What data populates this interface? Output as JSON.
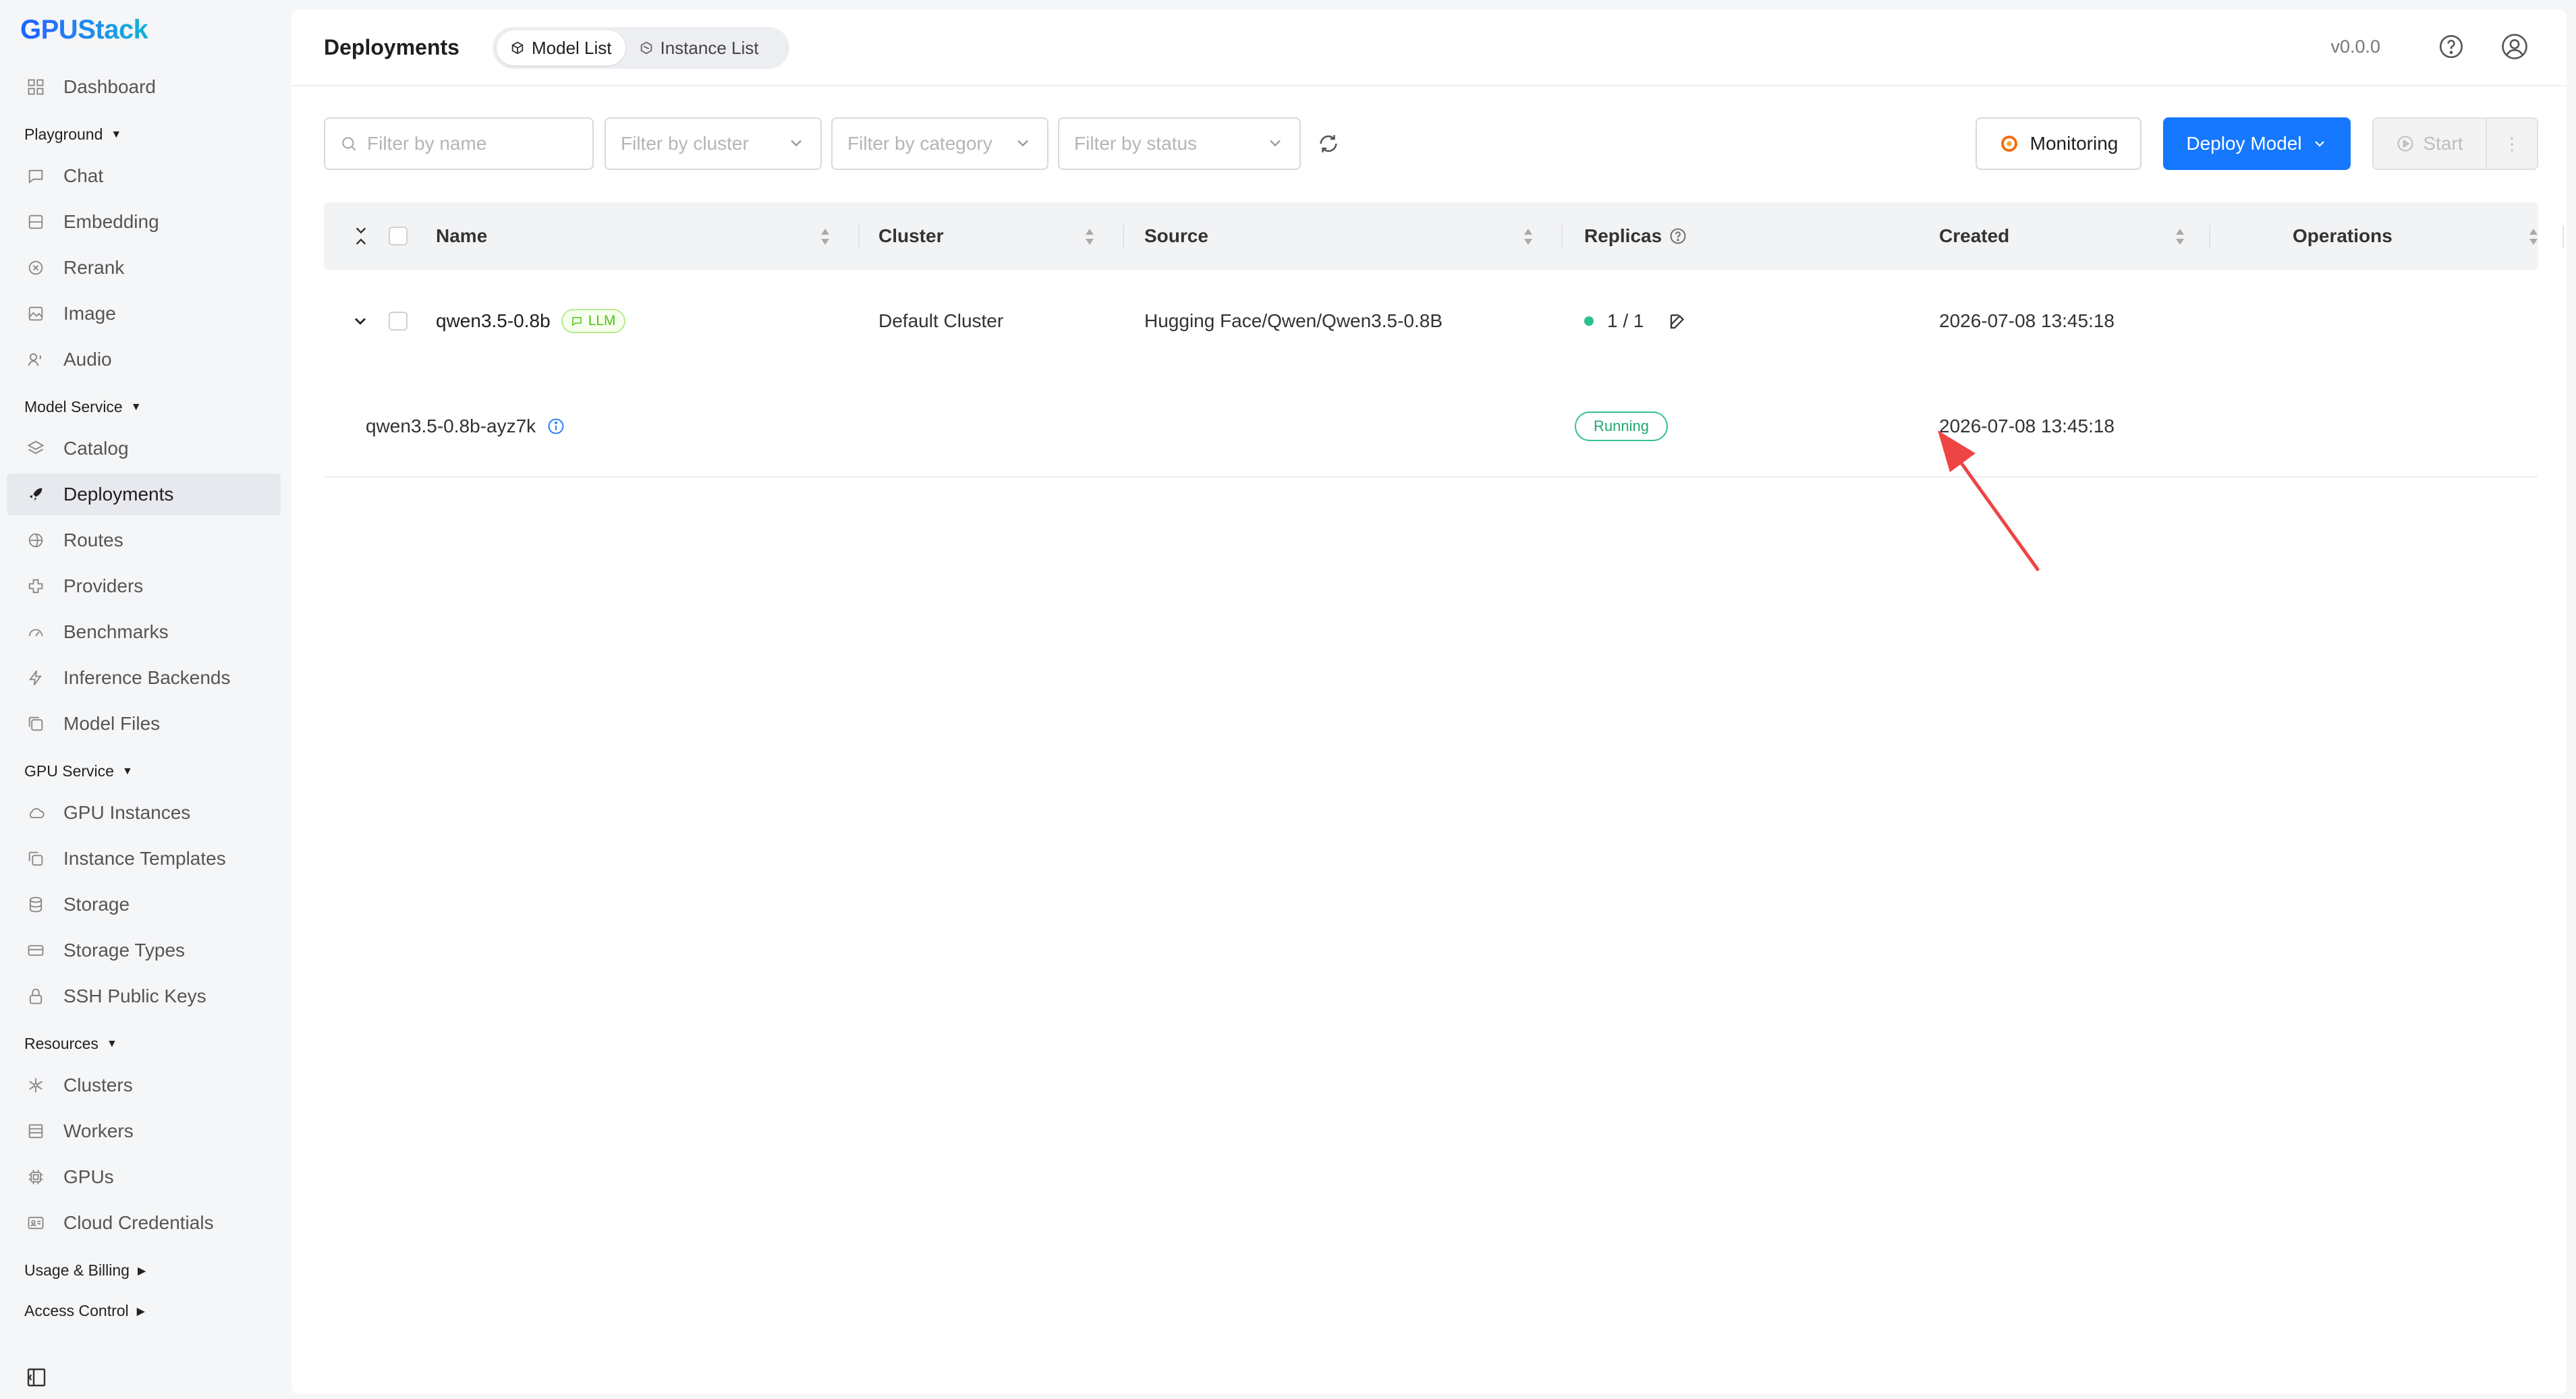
{
  "app": {
    "logo_first": "G",
    "logo_rest": "PUStack"
  },
  "sidebar": {
    "dashboard": "Dashboard",
    "groups": {
      "playground": "Playground",
      "model_service": "Model Service",
      "gpu_service": "GPU Service",
      "resources": "Resources",
      "usage_billing": "Usage & Billing",
      "access_control": "Access Control"
    },
    "items": {
      "chat": "Chat",
      "embedding": "Embedding",
      "rerank": "Rerank",
      "image": "Image",
      "audio": "Audio",
      "catalog": "Catalog",
      "deployments": "Deployments",
      "routes": "Routes",
      "providers": "Providers",
      "benchmarks": "Benchmarks",
      "inference_backends": "Inference Backends",
      "model_files": "Model Files",
      "gpu_instances": "GPU Instances",
      "instance_templates": "Instance Templates",
      "storage": "Storage",
      "storage_types": "Storage Types",
      "ssh_public_keys": "SSH Public Keys",
      "clusters": "Clusters",
      "workers": "Workers",
      "gpus": "GPUs",
      "cloud_credentials": "Cloud Credentials"
    },
    "active": "deployments"
  },
  "header": {
    "title": "Deployments",
    "tabs": [
      "Model List",
      "Instance List"
    ],
    "active_tab": "Model List",
    "version": "v0.0.0"
  },
  "toolbar": {
    "filter_name_placeholder": "Filter by name",
    "filter_cluster_placeholder": "Filter by cluster",
    "filter_category_placeholder": "Filter by category",
    "filter_status_placeholder": "Filter by status",
    "monitoring_label": "Monitoring",
    "deploy_label": "Deploy Model",
    "start_label": "Start"
  },
  "table": {
    "columns": {
      "name": "Name",
      "cluster": "Cluster",
      "source": "Source",
      "replicas": "Replicas",
      "created": "Created",
      "operations": "Operations"
    },
    "rows": [
      {
        "name": "qwen3.5-0.8b",
        "tag": "LLM",
        "cluster": "Default Cluster",
        "source": "Hugging Face/Qwen/Qwen3.5-0.8B",
        "replicas": "1 / 1",
        "created": "2026-07-08 13:45:18",
        "instances": [
          {
            "name": "qwen3.5-0.8b-ayz7k",
            "status": "Running",
            "created": "2026-07-08 13:45:18"
          }
        ]
      }
    ]
  },
  "colors": {
    "primary": "#1677ff",
    "running": "#22a873",
    "llm_tag": "#52c41a",
    "annotation_arrow": "#ef4444"
  }
}
